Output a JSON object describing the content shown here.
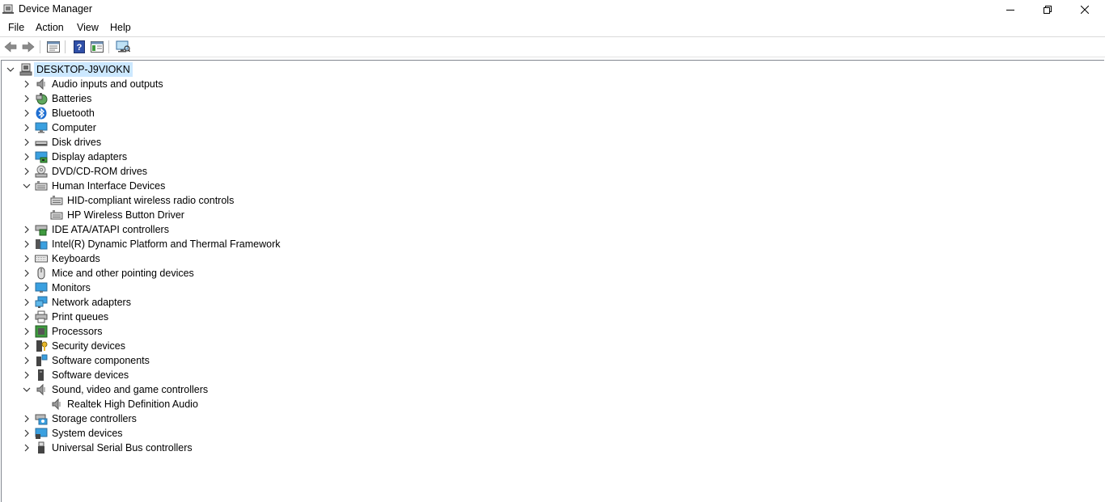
{
  "window": {
    "title": "Device Manager",
    "controls": {
      "minimize": "minimize",
      "maximize": "restore",
      "close": "close"
    }
  },
  "menu": [
    "File",
    "Action",
    "View",
    "Help"
  ],
  "toolbar": {
    "buttons": [
      "back-icon",
      "forward-icon",
      "properties-icon",
      "help-icon",
      "show-hide-console-tree-icon",
      "scan-hardware-changes-icon"
    ]
  },
  "tree": {
    "root": "DESKTOP-J9VIOKN",
    "categories": [
      {
        "label": "Audio inputs and outputs",
        "icon": "speaker-icon",
        "expanded": false
      },
      {
        "label": "Batteries",
        "icon": "battery-icon",
        "expanded": false
      },
      {
        "label": "Bluetooth",
        "icon": "bluetooth-icon",
        "expanded": false
      },
      {
        "label": "Computer",
        "icon": "computer-icon",
        "expanded": false
      },
      {
        "label": "Disk drives",
        "icon": "disk-drive-icon",
        "expanded": false
      },
      {
        "label": "Display adapters",
        "icon": "display-adapter-icon",
        "expanded": false
      },
      {
        "label": "DVD/CD-ROM drives",
        "icon": "dvd-drive-icon",
        "expanded": false
      },
      {
        "label": "Human Interface Devices",
        "icon": "hid-icon",
        "expanded": true,
        "children": [
          "HID-compliant wireless radio controls",
          "HP Wireless Button Driver"
        ]
      },
      {
        "label": "IDE ATA/ATAPI controllers",
        "icon": "ide-controller-icon",
        "expanded": false
      },
      {
        "label": "Intel(R) Dynamic Platform and Thermal Framework",
        "icon": "intel-dptf-icon",
        "expanded": false
      },
      {
        "label": "Keyboards",
        "icon": "keyboard-icon",
        "expanded": false
      },
      {
        "label": "Mice and other pointing devices",
        "icon": "mouse-icon",
        "expanded": false
      },
      {
        "label": "Monitors",
        "icon": "monitor-icon",
        "expanded": false
      },
      {
        "label": "Network adapters",
        "icon": "network-adapter-icon",
        "expanded": false
      },
      {
        "label": "Print queues",
        "icon": "printer-icon",
        "expanded": false
      },
      {
        "label": "Processors",
        "icon": "processor-icon",
        "expanded": false
      },
      {
        "label": "Security devices",
        "icon": "security-device-icon",
        "expanded": false
      },
      {
        "label": "Software components",
        "icon": "software-component-icon",
        "expanded": false
      },
      {
        "label": "Software devices",
        "icon": "software-device-icon",
        "expanded": false
      },
      {
        "label": "Sound, video and game controllers",
        "icon": "speaker-icon",
        "expanded": true,
        "children": [
          "Realtek High Definition Audio"
        ]
      },
      {
        "label": "Storage controllers",
        "icon": "storage-controller-icon",
        "expanded": false
      },
      {
        "label": "System devices",
        "icon": "system-device-icon",
        "expanded": false
      },
      {
        "label": "Universal Serial Bus controllers",
        "icon": "usb-icon",
        "expanded": false
      }
    ]
  },
  "colors": {
    "selection": "#cce8ff",
    "border": "#828790",
    "accent": "#0078d7"
  }
}
